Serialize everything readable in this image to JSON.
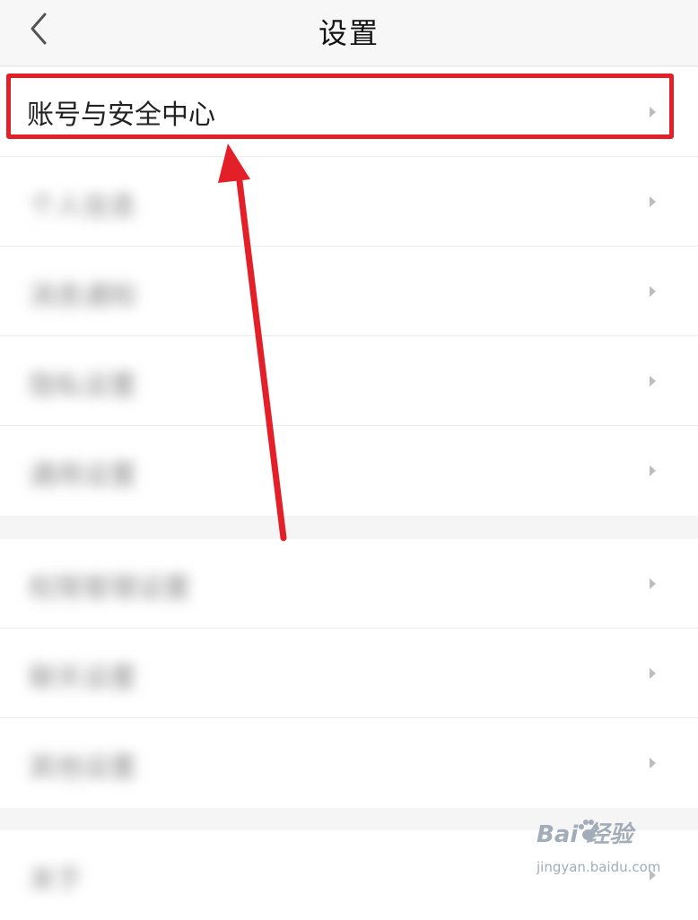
{
  "header": {
    "title": "设置",
    "back_icon": "chevron-left-icon"
  },
  "groups": [
    {
      "items": [
        {
          "label": "账号与安全中心",
          "blurred": false
        },
        {
          "label": "个人信息",
          "blurred": true
        },
        {
          "label": "消息通知",
          "blurred": true
        },
        {
          "label": "隐私设置",
          "blurred": true
        },
        {
          "label": "通用设置",
          "blurred": true
        }
      ]
    },
    {
      "items": [
        {
          "label": "权限管理设置",
          "blurred": true
        },
        {
          "label": "聊天设置",
          "blurred": true
        },
        {
          "label": "其他设置",
          "blurred": true
        }
      ]
    },
    {
      "items": [
        {
          "label": "关于",
          "blurred": true
        }
      ]
    }
  ],
  "annotation": {
    "color": "#e31f28"
  },
  "watermark": {
    "brand": "Bai  经验",
    "sub": "jingyan.baidu.com"
  }
}
